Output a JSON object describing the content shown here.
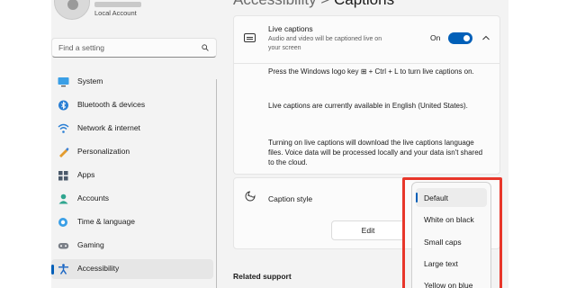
{
  "account": {
    "label": "Local Account"
  },
  "search": {
    "placeholder": "Find a setting"
  },
  "sidebar": {
    "items": [
      {
        "label": "System",
        "icon": "system-icon"
      },
      {
        "label": "Bluetooth & devices",
        "icon": "bluetooth-icon"
      },
      {
        "label": "Network & internet",
        "icon": "network-icon"
      },
      {
        "label": "Personalization",
        "icon": "personalization-icon"
      },
      {
        "label": "Apps",
        "icon": "apps-icon"
      },
      {
        "label": "Accounts",
        "icon": "accounts-icon"
      },
      {
        "label": "Time & language",
        "icon": "time-language-icon"
      },
      {
        "label": "Gaming",
        "icon": "gaming-icon"
      },
      {
        "label": "Accessibility",
        "icon": "accessibility-icon",
        "active": true
      }
    ]
  },
  "header": {
    "parent": "Accessibility",
    "separator": ">",
    "current": "Captions"
  },
  "live_captions": {
    "title": "Live captions",
    "description": "Audio and video will be captioned live on your screen",
    "toggle_state": "On",
    "paragraphs": [
      "Press the Windows logo key ⊞ + Ctrl + L to turn live captions on.",
      "Live captions are currently available in English (United States).",
      "Turning on live captions will download the live captions language files. Voice data will be processed locally and your data isn't shared to the cloud."
    ]
  },
  "caption_style": {
    "title": "Caption style",
    "edit_label": "Edit",
    "options": [
      "Default",
      "White on black",
      "Small caps",
      "Large text",
      "Yellow on blue"
    ],
    "selected": "Default"
  },
  "related": {
    "title": "Related support"
  },
  "colors": {
    "accent": "#005fb8",
    "highlight": "#e8362a"
  }
}
